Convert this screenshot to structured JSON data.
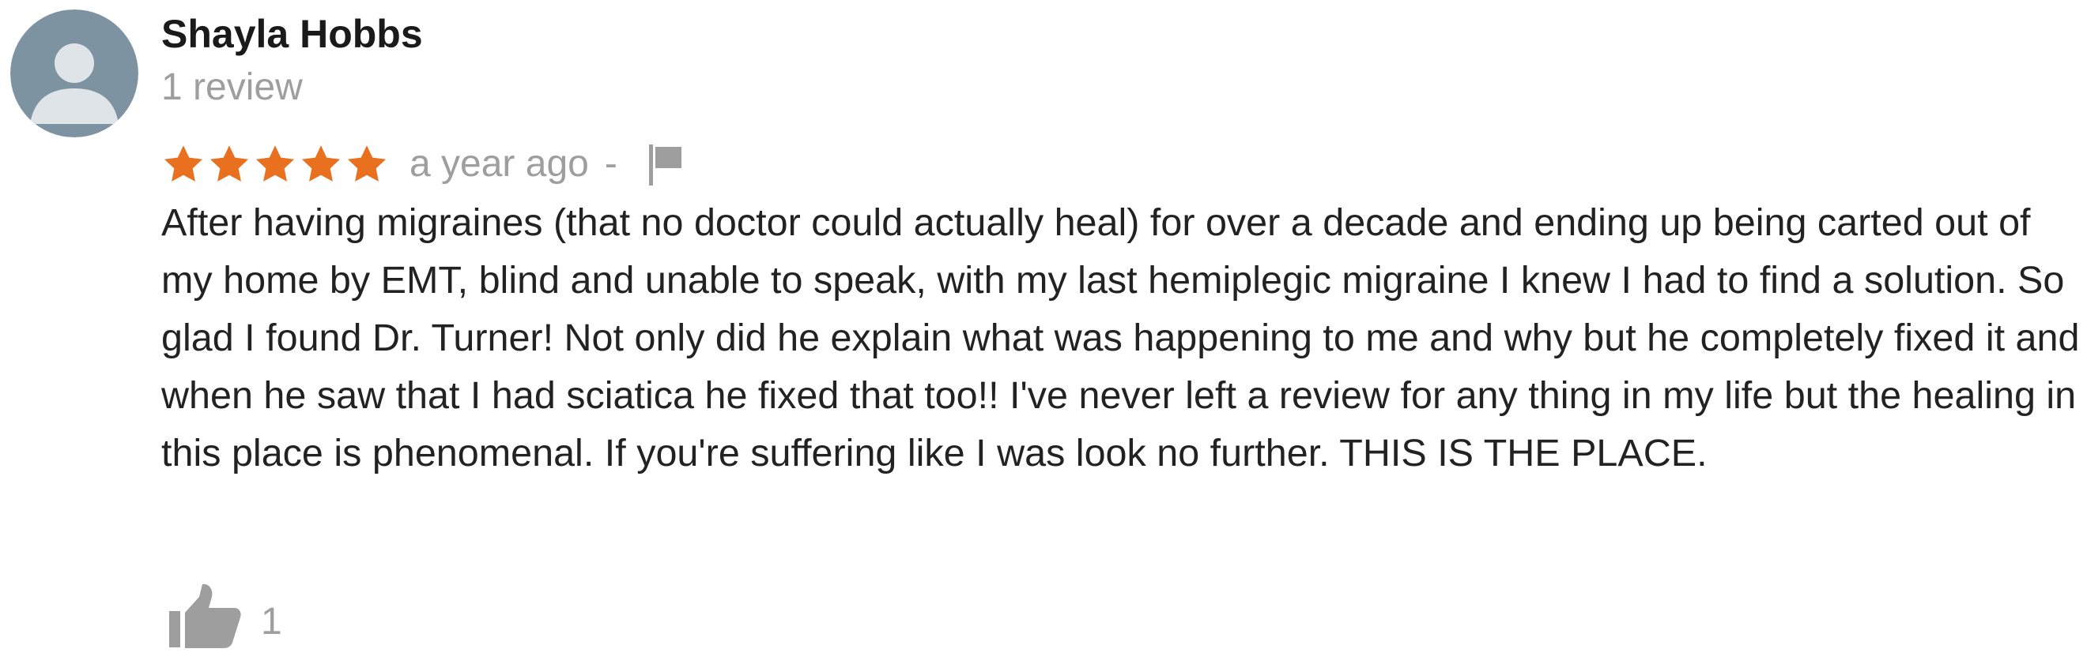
{
  "review": {
    "author_name": "Shayla Hobbs",
    "review_count": "1 review",
    "rating": 5,
    "rating_max": 5,
    "time_ago": "a year ago",
    "separator": "-",
    "text": "After having migraines (that no doctor could actually heal) for over a decade and ending up being carted out of my home by EMT, blind and unable to speak, with my last hemiplegic migraine I knew I had to find a solution. So glad I found Dr. Turner! Not only did he explain what was happening to me and why but he completely fixed it and when he saw that I had sciatica he fixed that too!! I've never left a review for any thing in my life but the healing in this place is phenomenal. If you're suffering like I was look no further. THIS IS THE PLACE.",
    "like_count": "1"
  },
  "icons": {
    "avatar": "default-person-avatar",
    "star": "star-icon",
    "flag": "flag-icon",
    "like": "thumbs-up-icon"
  },
  "colors": {
    "star": "#e8701f",
    "muted_text": "#9e9e9e",
    "body_text": "#222222",
    "avatar_bg": "#7d93a2",
    "avatar_figure": "#dfe4e8",
    "icon_gray": "#9e9e9e"
  }
}
